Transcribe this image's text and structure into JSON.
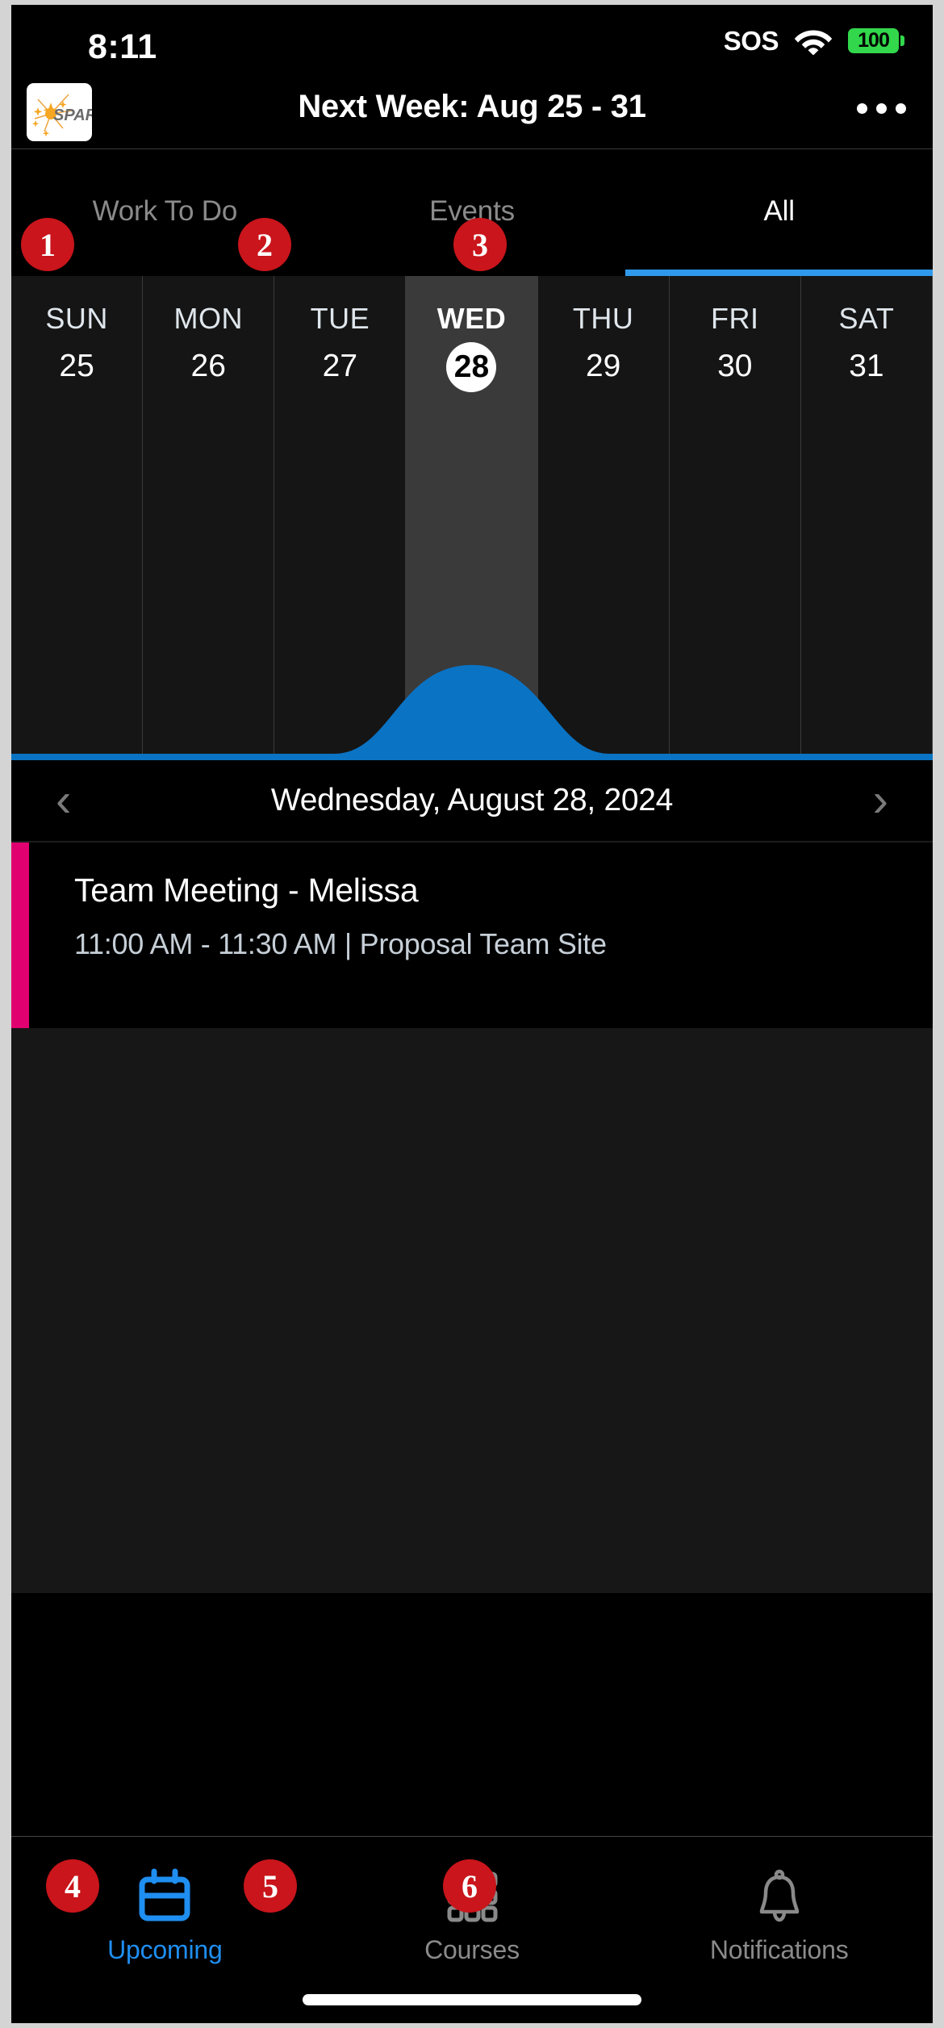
{
  "status_bar": {
    "time": "8:11",
    "sos": "SOS",
    "wifi_icon": "wifi-icon",
    "battery_level": "100"
  },
  "header": {
    "logo_alt": "SPARK",
    "logo_wordmark": "SPARK",
    "title": "Next Week: Aug 25 - 31",
    "more_icon": "ellipsis-horizontal-icon"
  },
  "tabs": [
    {
      "label": "Work To Do",
      "active": false,
      "badge": "1"
    },
    {
      "label": "Events",
      "active": false,
      "badge": "2"
    },
    {
      "label": "All",
      "active": true,
      "badge": "3"
    }
  ],
  "week_strip": {
    "days": [
      {
        "name": "SUN",
        "num": "25",
        "selected": false
      },
      {
        "name": "MON",
        "num": "26",
        "selected": false
      },
      {
        "name": "TUE",
        "num": "27",
        "selected": false
      },
      {
        "name": "WED",
        "num": "28",
        "selected": true
      },
      {
        "name": "THU",
        "num": "29",
        "selected": false
      },
      {
        "name": "FRI",
        "num": "30",
        "selected": false
      },
      {
        "name": "SAT",
        "num": "31",
        "selected": false
      }
    ],
    "curve_color": "#0a73c4",
    "selected_column_bg": "#3a3a3a"
  },
  "date_nav": {
    "prev_icon": "chevron-left-icon",
    "date": "Wednesday, August 28, 2024",
    "next_icon": "chevron-right-icon"
  },
  "events": [
    {
      "title": "Team Meeting - Melissa",
      "meta": "11:00 AM - 11:30 AM | Proposal Team Site",
      "accent_color": "#e00070"
    }
  ],
  "bottom_nav": [
    {
      "label": "Upcoming",
      "icon": "calendar-icon",
      "active": true,
      "badge": "4"
    },
    {
      "label": "Courses",
      "icon": "grid-3x3-icon",
      "active": false,
      "badge": "5"
    },
    {
      "label": "Notifications",
      "icon": "bell-icon",
      "active": false,
      "badge": "6"
    }
  ],
  "colors": {
    "accent_blue": "#1f8ef1",
    "curve_blue": "#0a73c4",
    "badge_red": "#c9151b",
    "event_pink": "#e00070",
    "battery_green": "#32d74b"
  }
}
